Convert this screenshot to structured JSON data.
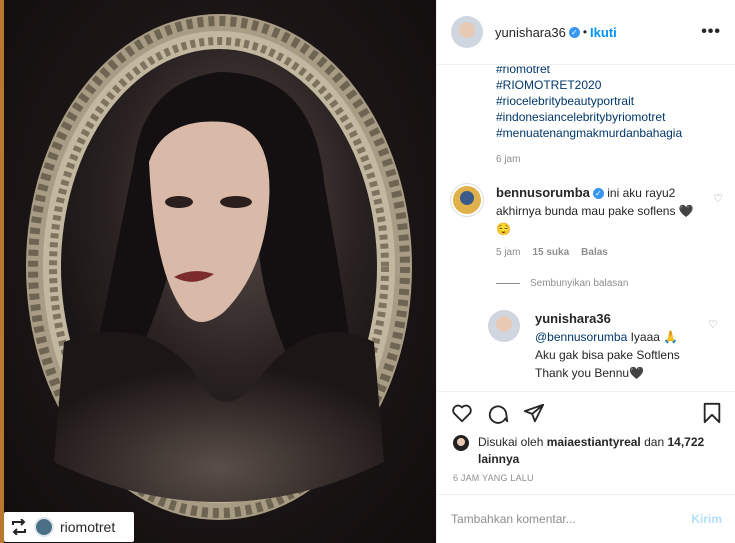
{
  "header": {
    "username": "yunishara36",
    "separator": "•",
    "follow_label": "Ikuti",
    "more_label": "•••"
  },
  "image": {
    "repost_username": "riomotret"
  },
  "caption": {
    "hashtags": [
      "#riomotret",
      "#RIOMOTRET2020",
      "#riocelebritybeautyportrait",
      "#indonesiancelebritybyriomotret",
      "#menuatenangmakmurdanbahagia"
    ],
    "time": "6 jam"
  },
  "comments": [
    {
      "username": "bennusorumba",
      "text": "ini aku rayu2 akhirnya bunda mau pake soflens 🖤😌",
      "time": "5 jam",
      "likes": "15 suka",
      "reply_label": "Balas"
    }
  ],
  "hide_replies_label": "Sembunyikan balasan",
  "reply": {
    "username": "yunishara36",
    "mention": "@bennusorumba",
    "text_after_mention": " Iyaaa 🙏 Aku gak bisa pake Softlens Thank you Bennu🖤"
  },
  "likes": {
    "prefix": "Disukai oleh ",
    "user": "maiaestiantyreal",
    "middle": " dan ",
    "count": "14,722 lainnya"
  },
  "posted_ago": "6 JAM YANG LALU",
  "add_comment": {
    "placeholder": "Tambahkan komentar...",
    "send_label": "Kirim"
  },
  "colors": {
    "accent": "#0095f6",
    "link": "#00376b",
    "muted": "#8e8e8e",
    "send_disabled": "#b2dffc"
  }
}
